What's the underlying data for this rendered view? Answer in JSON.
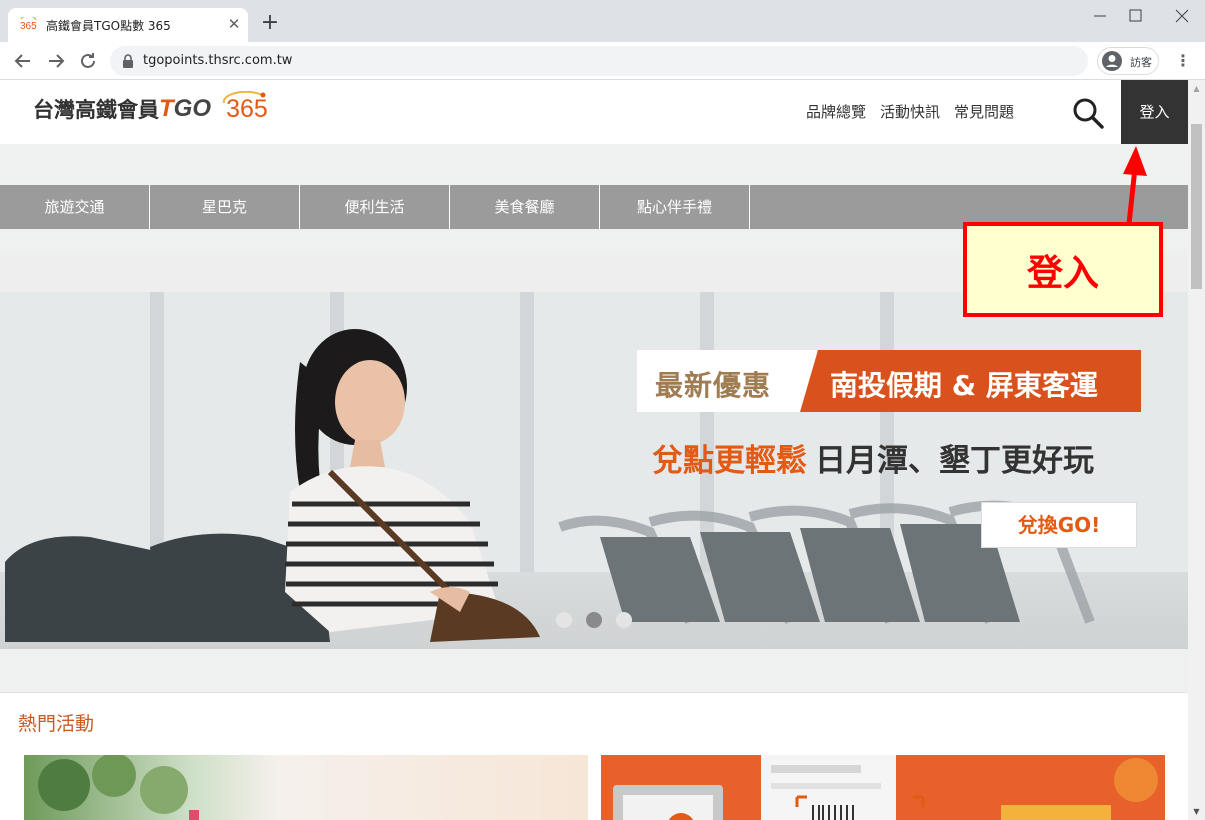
{
  "browser": {
    "tab_title": "高鐵會員TGO點數 365",
    "favicon_label": "365",
    "url": "tgopoints.thsrc.com.tw",
    "profile_label": "訪客"
  },
  "site": {
    "logo": {
      "chinese": "台灣高鐵會員",
      "t": "T",
      "go": "GO",
      "number": "365"
    },
    "top_nav": [
      "品牌總覽",
      "活動快訊",
      "常見問題"
    ],
    "login_label": "登入",
    "categories": [
      "旅遊交通",
      "星巴克",
      "便利生活",
      "美食餐廳",
      "點心伴手禮"
    ],
    "banner": {
      "tag": "最新優惠",
      "headline": "南投假期 & 屏東客運",
      "sub_highlight": "兌點更輕鬆",
      "sub_rest": "日月潭、墾丁更好玩",
      "cta": "兌換GO!",
      "slide_count": 3,
      "active_slide": 2
    },
    "hot_title": "熱門活動"
  },
  "annotation": {
    "text": "登入",
    "color": "#ff0000",
    "fill": "#ffffd0"
  },
  "colors": {
    "brand_orange": "#e35a14",
    "category_bar": "#9b9b9b",
    "login_bg": "#333333"
  }
}
